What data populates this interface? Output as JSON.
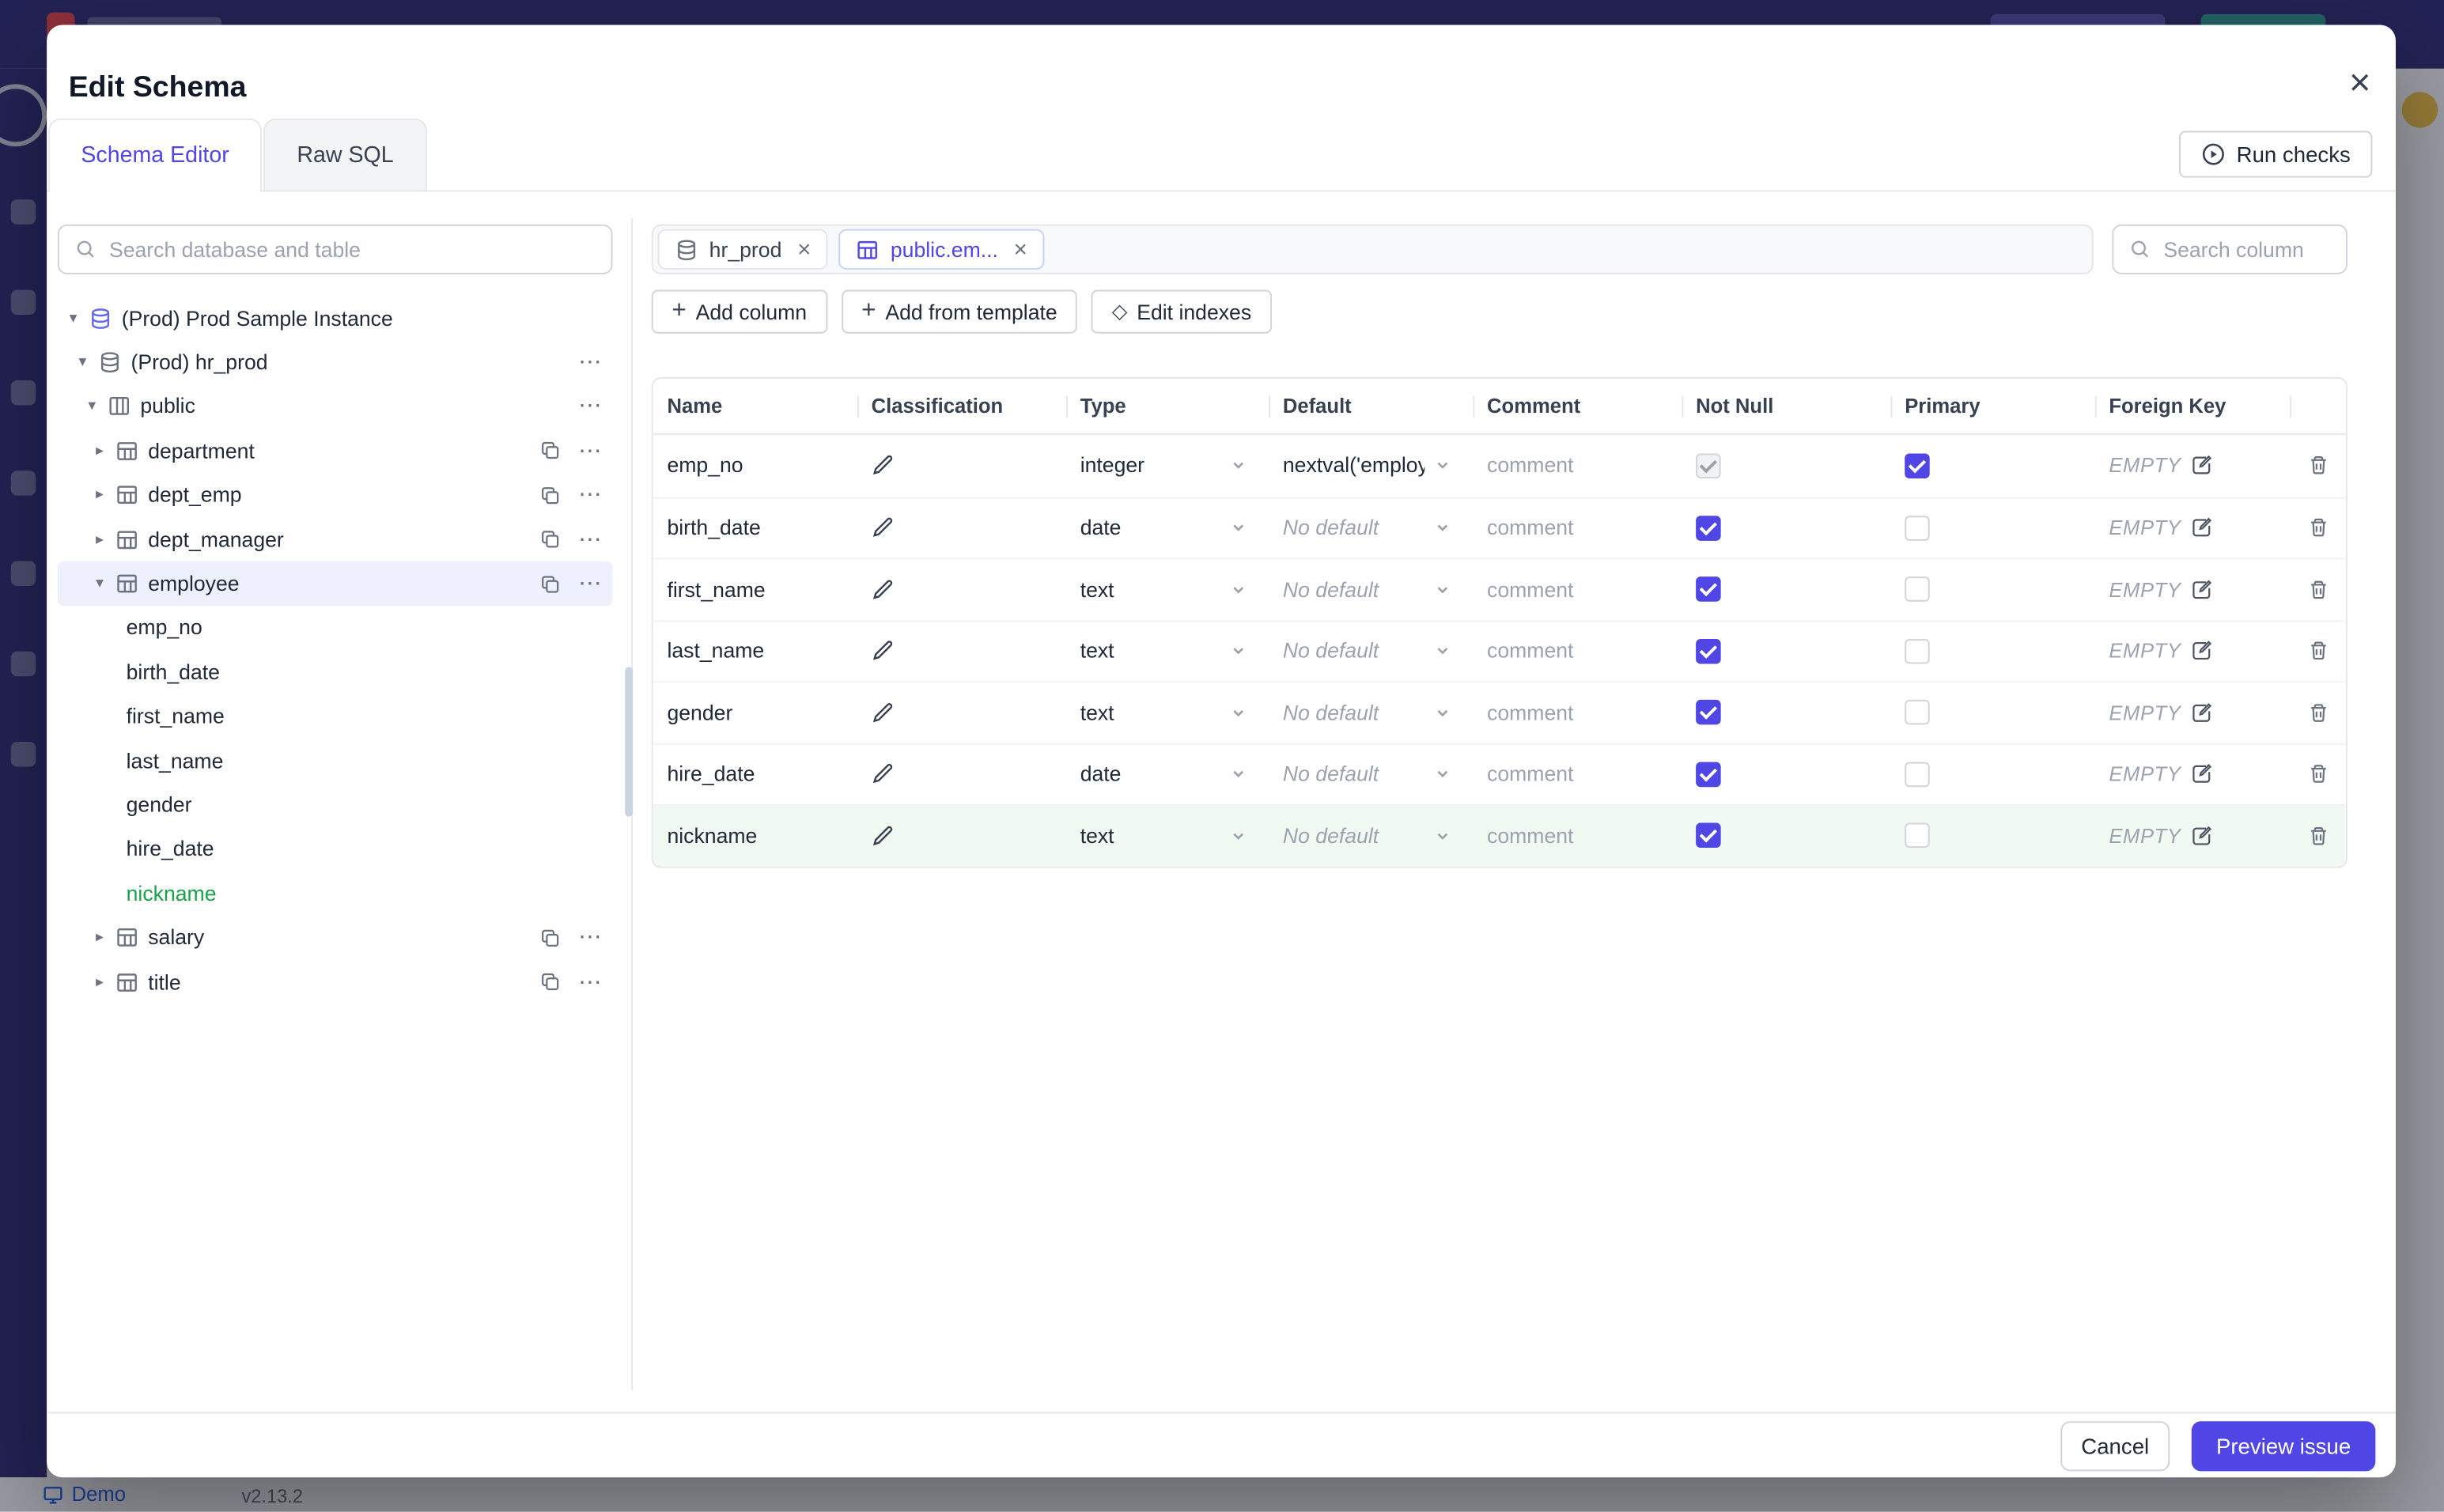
{
  "app": {
    "demo_label": "Demo",
    "version": "v2.13.2"
  },
  "modal": {
    "title": "Edit Schema",
    "close_glyph": "×",
    "tabs": {
      "schema_editor": "Schema Editor",
      "raw_sql": "Raw SQL"
    },
    "run_checks": "Run checks",
    "footer": {
      "cancel": "Cancel",
      "preview_issue": "Preview issue"
    }
  },
  "sidebar": {
    "search_placeholder": "Search database and table",
    "tree": [
      {
        "label": "(Prod) Prod Sample Instance",
        "type": "instance",
        "expanded": true
      },
      {
        "label": "(Prod) hr_prod",
        "type": "database",
        "expanded": true
      },
      {
        "label": "public",
        "type": "schema",
        "expanded": true
      },
      {
        "label": "department",
        "type": "table",
        "expanded": false
      },
      {
        "label": "dept_emp",
        "type": "table",
        "expanded": false
      },
      {
        "label": "dept_manager",
        "type": "table",
        "expanded": false
      },
      {
        "label": "employee",
        "type": "table",
        "expanded": true,
        "selected": true
      },
      {
        "label": "emp_no",
        "type": "column"
      },
      {
        "label": "birth_date",
        "type": "column"
      },
      {
        "label": "first_name",
        "type": "column"
      },
      {
        "label": "last_name",
        "type": "column"
      },
      {
        "label": "gender",
        "type": "column"
      },
      {
        "label": "hire_date",
        "type": "column"
      },
      {
        "label": "nickname",
        "type": "column",
        "added": true
      },
      {
        "label": "salary",
        "type": "table",
        "expanded": false
      },
      {
        "label": "title",
        "type": "table",
        "expanded": false
      }
    ]
  },
  "editor": {
    "chips": [
      {
        "label": "hr_prod",
        "active": false
      },
      {
        "label": "public.em...",
        "active": true
      }
    ],
    "column_search_placeholder": "Search column",
    "toolbar": {
      "add_column": "Add column",
      "add_from_template": "Add from template",
      "edit_indexes": "Edit indexes"
    },
    "table": {
      "headers": {
        "name": "Name",
        "classification": "Classification",
        "type": "Type",
        "default": "Default",
        "comment": "Comment",
        "not_null": "Not Null",
        "primary": "Primary",
        "foreign_key": "Foreign Key"
      },
      "comment_placeholder": "comment",
      "fk_empty": "EMPTY",
      "rows": [
        {
          "name": "emp_no",
          "type": "integer",
          "default": "nextval('employ",
          "default_is_placeholder": false,
          "not_null": true,
          "not_null_disabled": true,
          "primary": true,
          "highlighted": false
        },
        {
          "name": "birth_date",
          "type": "date",
          "default": "No default",
          "default_is_placeholder": true,
          "not_null": true,
          "not_null_disabled": false,
          "primary": false,
          "highlighted": false
        },
        {
          "name": "first_name",
          "type": "text",
          "default": "No default",
          "default_is_placeholder": true,
          "not_null": true,
          "not_null_disabled": false,
          "primary": false,
          "highlighted": false
        },
        {
          "name": "last_name",
          "type": "text",
          "default": "No default",
          "default_is_placeholder": true,
          "not_null": true,
          "not_null_disabled": false,
          "primary": false,
          "highlighted": false
        },
        {
          "name": "gender",
          "type": "text",
          "default": "No default",
          "default_is_placeholder": true,
          "not_null": true,
          "not_null_disabled": false,
          "primary": false,
          "highlighted": false
        },
        {
          "name": "hire_date",
          "type": "date",
          "default": "No default",
          "default_is_placeholder": true,
          "not_null": true,
          "not_null_disabled": false,
          "primary": false,
          "highlighted": false
        },
        {
          "name": "nickname",
          "type": "text",
          "default": "No default",
          "default_is_placeholder": true,
          "not_null": true,
          "not_null_disabled": false,
          "primary": false,
          "highlighted": true
        }
      ]
    }
  }
}
